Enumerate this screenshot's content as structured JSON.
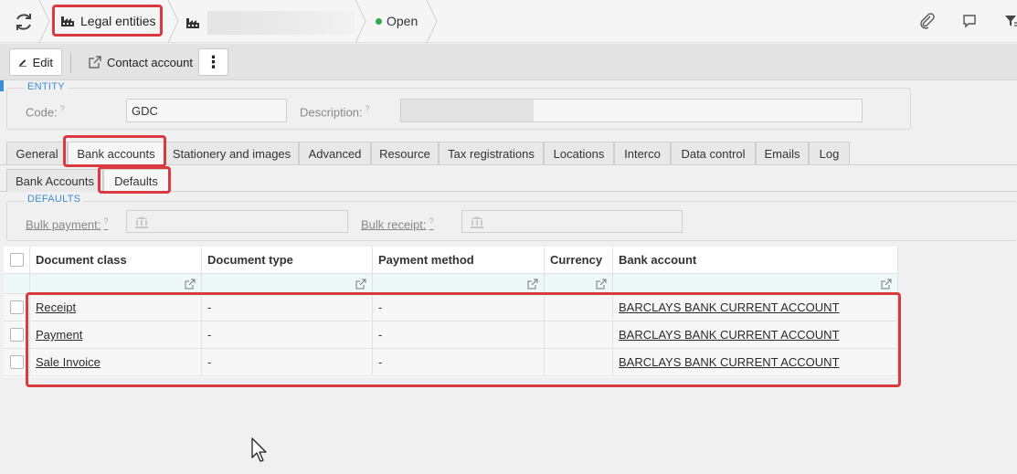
{
  "breadcrumb": {
    "legal_entities": "Legal entities",
    "status": "Open"
  },
  "toolbar": {
    "edit_label": "Edit",
    "contact_label": "Contact account",
    "more_label": "⋮"
  },
  "entity": {
    "legend": "ENTITY",
    "code_label": "Code:",
    "code_value": "GDC",
    "description_label": "Description:",
    "help_mark": "?"
  },
  "tabs": [
    {
      "label": "General"
    },
    {
      "label": "Bank accounts"
    },
    {
      "label": "Stationery and images"
    },
    {
      "label": "Advanced"
    },
    {
      "label": "Resource"
    },
    {
      "label": "Tax registrations"
    },
    {
      "label": "Locations"
    },
    {
      "label": "Interco"
    },
    {
      "label": "Data control"
    },
    {
      "label": "Emails"
    },
    {
      "label": "Log"
    }
  ],
  "subtabs": [
    {
      "label": "Bank Accounts"
    },
    {
      "label": "Defaults"
    }
  ],
  "defaults": {
    "legend": "DEFAULTS",
    "bulk_payment_label": "Bulk payment:",
    "bulk_receipt_label": "Bulk receipt:"
  },
  "grid": {
    "columns": [
      "Document class",
      "Document type",
      "Payment method",
      "Currency",
      "Bank account"
    ],
    "rows": [
      {
        "document_class": "Receipt",
        "document_type": "-",
        "payment_method": "-",
        "currency": "",
        "bank_account": "BARCLAYS BANK CURRENT ACCOUNT"
      },
      {
        "document_class": "Payment",
        "document_type": "-",
        "payment_method": "-",
        "currency": "",
        "bank_account": "BARCLAYS BANK CURRENT ACCOUNT"
      },
      {
        "document_class": "Sale Invoice",
        "document_type": "-",
        "payment_method": "-",
        "currency": "",
        "bank_account": "BARCLAYS BANK CURRENT ACCOUNT"
      }
    ]
  },
  "colors": {
    "highlight": "#d9393f",
    "accent": "#3b8fd4",
    "status_open": "#2eab4b"
  },
  "icons": [
    "refresh-icon",
    "factory-icon",
    "paperclip-icon",
    "comment-icon",
    "filter-icon",
    "pencil-icon",
    "external-link-icon",
    "bank-icon",
    "cursor-icon"
  ]
}
